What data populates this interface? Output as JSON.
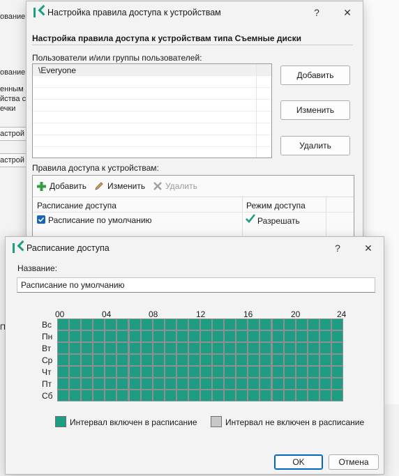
{
  "background": {
    "texts": [
      "ование",
      "ование",
      "енным н",
      "йства с",
      "ечки",
      "астрой",
      "астрой",
      "П"
    ]
  },
  "access_dialog": {
    "title": "Настройка правила доступа к устройствам",
    "help": "?",
    "close": "✕",
    "heading": "Настройка правила доступа к устройствам типа Съемные диски",
    "users_label": "Пользователи и/или группы пользователей:",
    "users": [
      "\\Everyone"
    ],
    "btn_add": "Добавить",
    "btn_edit": "Изменить",
    "btn_delete": "Удалить",
    "rules_label": "Правила доступа к устройствам:",
    "toolbar": {
      "add": "Добавить",
      "edit": "Изменить",
      "delete": "Удалить"
    },
    "col_schedule": "Расписание доступа",
    "col_mode": "Режим доступа",
    "rule_schedule": "Расписание по умолчанию",
    "rule_mode": "Разрешать"
  },
  "schedule_dialog": {
    "title": "Расписание доступа",
    "help": "?",
    "close": "✕",
    "name_label": "Название:",
    "name_value": "Расписание по умолчанию",
    "hours": [
      "00",
      "04",
      "08",
      "12",
      "16",
      "20",
      "24"
    ],
    "days": [
      "Вс",
      "Пн",
      "Вт",
      "Ср",
      "Чт",
      "Пт",
      "Сб"
    ],
    "legend_on": "Интервал включен в расписание",
    "legend_off": "Интервал не включен в расписание",
    "ok": "OK",
    "cancel": "Отмена"
  },
  "colors": {
    "accent": "#1d9d84",
    "grid": "#1d9d84",
    "off": "#c8c8c8",
    "ok_border": "#0067c0"
  }
}
